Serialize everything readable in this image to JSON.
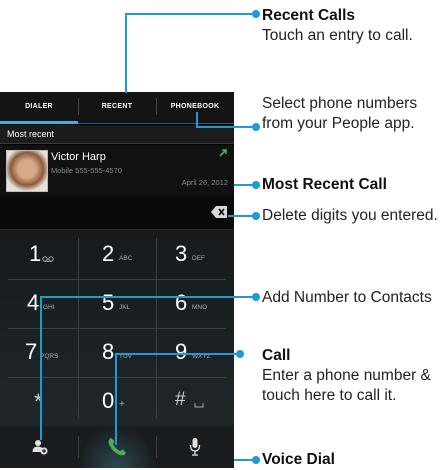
{
  "tabs": {
    "dialer": "DIALER",
    "recent": "RECENT",
    "phonebook": "PHONEBOOK"
  },
  "section_header": "Most recent",
  "recent_call": {
    "name": "Victor Harp",
    "number": "Mobile 555-555-4570",
    "date": "April 26, 2012"
  },
  "keys": [
    {
      "digit": "1",
      "letters": ""
    },
    {
      "digit": "2",
      "letters": "ABC"
    },
    {
      "digit": "3",
      "letters": "DEF"
    },
    {
      "digit": "4",
      "letters": "GHI"
    },
    {
      "digit": "5",
      "letters": "JKL"
    },
    {
      "digit": "6",
      "letters": "MNO"
    },
    {
      "digit": "7",
      "letters": "PQRS"
    },
    {
      "digit": "8",
      "letters": "TUV"
    },
    {
      "digit": "9",
      "letters": "WXYZ"
    },
    {
      "digit": "*",
      "letters": ""
    },
    {
      "digit": "0",
      "letters": "+"
    },
    {
      "digit": "#",
      "letters": ""
    }
  ],
  "callouts": {
    "recent_calls": {
      "title": "Recent Calls",
      "body": "Touch an entry to call."
    },
    "phonebook": {
      "body": "Select phone numbers from your People app."
    },
    "most_recent": {
      "title": "Most Recent Call"
    },
    "delete": {
      "body": "Delete digits you entered."
    },
    "add_number": {
      "body": "Add Number to Contacts"
    },
    "call": {
      "title": "Call",
      "body": "Enter a phone number & touch here to call it."
    },
    "voice_dial": {
      "title": "Voice Dial"
    }
  },
  "colors": {
    "accent": "#33b5e5",
    "leader": "#1e9ad6",
    "call_green": "#4caf50"
  }
}
